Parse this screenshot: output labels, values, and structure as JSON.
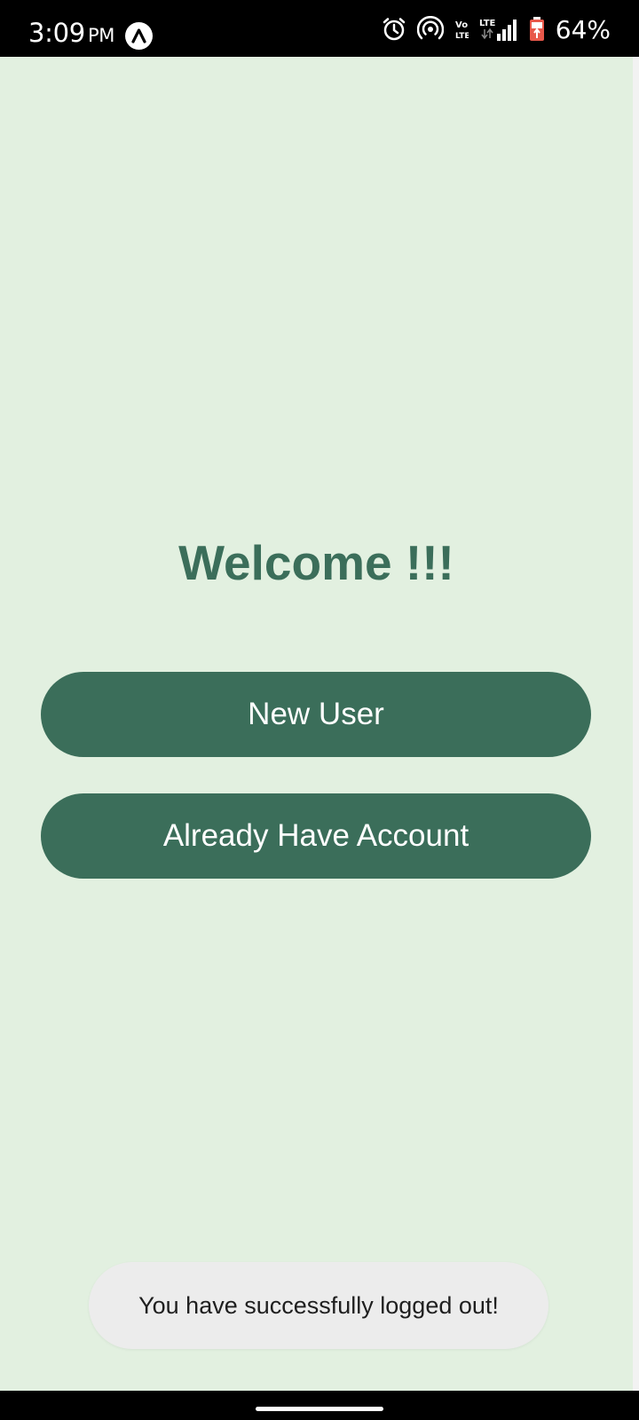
{
  "status_bar": {
    "time": "3:09",
    "ampm": "PM",
    "battery_percent": "64%",
    "icons": [
      "app-badge-icon",
      "alarm-icon",
      "hotspot-icon",
      "volte-icon",
      "lte-icon",
      "signal-icon",
      "battery-icon"
    ]
  },
  "main": {
    "title": "Welcome !!!",
    "new_user_button": "New User",
    "existing_account_button": "Already Have Account"
  },
  "toast": {
    "message": "You have successfully logged out!"
  },
  "colors": {
    "background": "#e2f0e0",
    "primary": "#3b6e5a",
    "toast_background": "#ececec",
    "battery_accent": "#e8584a"
  }
}
